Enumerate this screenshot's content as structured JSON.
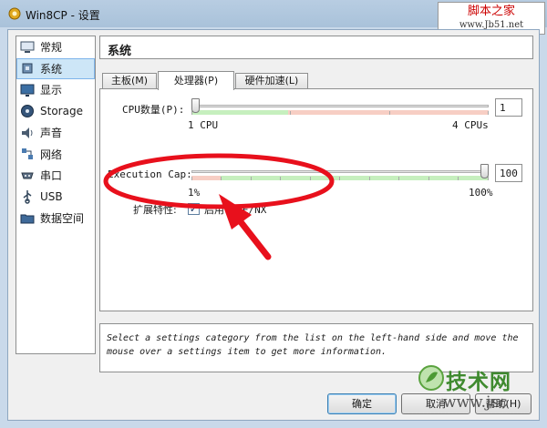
{
  "window": {
    "title": "Win8CP - 设置",
    "icon": "gear-icon"
  },
  "watermark_top": {
    "line1": "脚本之家",
    "line2": "www.Jb51.net"
  },
  "sidebar": {
    "items": [
      {
        "label": "常规",
        "icon": "monitor-icon"
      },
      {
        "label": "系统",
        "icon": "chip-icon",
        "active": true
      },
      {
        "label": "显示",
        "icon": "display-icon"
      },
      {
        "label": "Storage",
        "icon": "disk-icon"
      },
      {
        "label": "声音",
        "icon": "speaker-icon"
      },
      {
        "label": "网络",
        "icon": "network-icon"
      },
      {
        "label": "串口",
        "icon": "serial-icon"
      },
      {
        "label": "USB",
        "icon": "usb-icon"
      },
      {
        "label": "数据空间",
        "icon": "folder-icon"
      }
    ]
  },
  "section": {
    "title": "系统"
  },
  "tabs": [
    {
      "label": "主板(M)"
    },
    {
      "label": "处理器(P)",
      "active": true
    },
    {
      "label": "硬件加速(L)"
    }
  ],
  "processor": {
    "cpu_label": "CPU数量(P):",
    "cpu_value": "1",
    "cpu_min_label": "1  CPU",
    "cpu_max_label": "4  CPUs",
    "cpu_fraction": 0.0,
    "cap_label": "Execution Cap:",
    "cap_value": "100",
    "cap_min_label": "1%",
    "cap_max_label": "100%",
    "cap_fraction": 1.0,
    "ext_label": "扩展特性:",
    "pae_label": "启用 PAE/NX",
    "pae_checked": true,
    "pae_mark": "✓"
  },
  "info": {
    "text": "Select a settings category from the list on the left-hand side and move the mouse over a settings item to get more information."
  },
  "buttons": {
    "ok": "确定",
    "cancel": "取消",
    "help": "帮助(H)"
  },
  "watermark_bottom": {
    "logo": "技术网",
    "url": "www.jsc"
  },
  "colors": {
    "annotation": "#e8101c",
    "green_zone": "#c6efbe",
    "red_zone": "#f7cec4",
    "selection": "#cde6f7"
  }
}
